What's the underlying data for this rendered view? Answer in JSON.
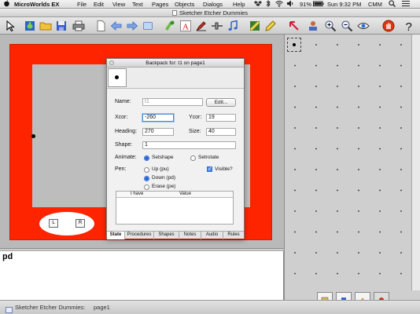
{
  "menubar": {
    "apple": "",
    "app": "MicroWorlds EX",
    "menus": [
      "File",
      "Edit",
      "View",
      "Text",
      "Pages",
      "Objects",
      "Dialogs",
      "Help"
    ],
    "battery": "91%",
    "clock": "Sun 9:32 PM",
    "user": "CMM"
  },
  "window": {
    "title": "Sketcher Etcher Dummies"
  },
  "toolbar": {
    "tools": [
      "cursor-tool",
      "turtle-tool",
      "open-tool",
      "save-tool",
      "print-tool",
      "new-page-tool",
      "back-tool",
      "forward-tool",
      "page-tool",
      "paint-tool",
      "text-tool",
      "pen-tool",
      "slider-tool",
      "music-tool",
      "hatch-tool",
      "pencil-tool",
      "pointer-tool",
      "stamp-tool",
      "zoom-in-tool",
      "zoom-out-tool",
      "eye-tool",
      "stop-tool",
      "help-tool"
    ]
  },
  "stage": {
    "knobs": {
      "left": "L",
      "right": "R"
    }
  },
  "backpack": {
    "title": "Backpack for: t1 on page1",
    "name_label": "Name:",
    "name_value": "t1",
    "edit_button": "Edit...",
    "xcor_label": "Xcor:",
    "xcor_value": "-260",
    "ycor_label": "Ycor:",
    "ycor_value": "19",
    "heading_label": "Heading:",
    "heading_value": "270",
    "size_label": "Size:",
    "size_value": "40",
    "shape_label": "Shape:",
    "shape_value": "1",
    "animate_label": "Animate:",
    "animate_setshape": "Setshape",
    "animate_setrotate": "Setrotate",
    "pen_label": "Pen:",
    "pen_up": "Up (pu)",
    "pen_down": "Down (pd)",
    "pen_erase": "Erase (pe)",
    "visible_label": "Visible?",
    "table_headers": {
      "have": "I have",
      "value": "Value"
    },
    "tabs": [
      "State",
      "Procedures",
      "Shapes",
      "Notes",
      "Audio",
      "Rules"
    ]
  },
  "command_center": {
    "text": "pd"
  },
  "statusbar": {
    "project": "Sketcher Etcher Dummies:",
    "page": "page1"
  }
}
